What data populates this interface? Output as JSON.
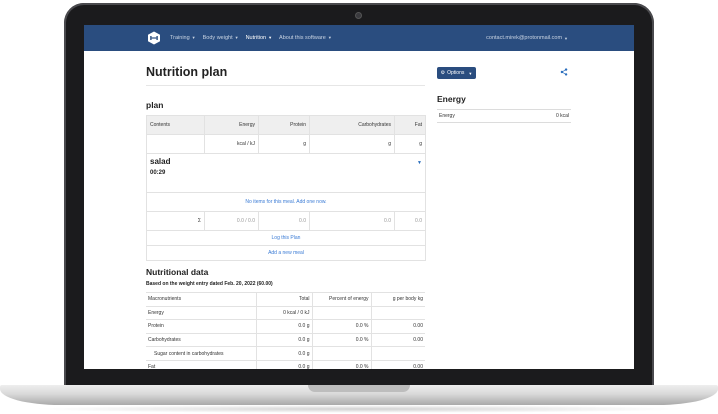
{
  "nav": {
    "items": [
      {
        "label": "Training"
      },
      {
        "label": "Body weight"
      },
      {
        "label": "Nutrition"
      },
      {
        "label": "About this software"
      }
    ],
    "user": "contact.mirek@protonmail.com"
  },
  "page": {
    "title": "Nutrition plan",
    "options_label": "Options"
  },
  "energy_panel": {
    "title": "Energy",
    "label": "Energy",
    "value": "0 kcal"
  },
  "plan": {
    "title": "plan",
    "headers": [
      "Contents",
      "Energy",
      "Protein",
      "Carbohydrates",
      "Fat"
    ],
    "units": [
      "",
      "kcal / kJ",
      "g",
      "g",
      "g"
    ],
    "meal": {
      "name": "salad",
      "time": "00:29",
      "empty_text": "No items for this meal. Add one now."
    },
    "totals": [
      "Σ",
      "0.0 / 0.0",
      "0.0",
      "0.0",
      "0.0"
    ],
    "log_link": "Log this Plan",
    "add_meal_link": "Add a new meal"
  },
  "nutritional": {
    "title": "Nutritional data",
    "subtitle": "Based on the weight entry dated Feb. 20, 2022 (60.00)",
    "headers": [
      "Macronutrients",
      "Total",
      "Percent of energy",
      "g per body kg"
    ],
    "rows": [
      [
        "Energy",
        "0 kcal / 0 kJ",
        "",
        ""
      ],
      [
        "Protein",
        "0.0 g",
        "0.0 %",
        "0.00"
      ],
      [
        "Carbohydrates",
        "0.0 g",
        "0.0 %",
        "0.00"
      ],
      [
        "Sugar content in carbohydrates",
        "0.0 g",
        "",
        ""
      ],
      [
        "Fat",
        "0.0 g",
        "0.0 %",
        "0.00"
      ]
    ]
  }
}
